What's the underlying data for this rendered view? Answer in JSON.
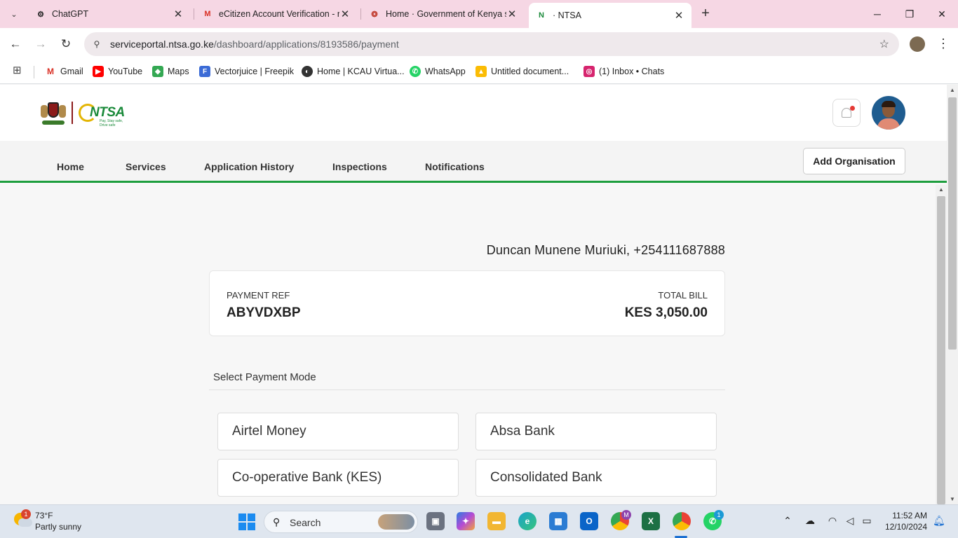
{
  "browser": {
    "tabs": [
      {
        "title": "ChatGPT",
        "icon": "chatgpt-icon"
      },
      {
        "title": "eCitizen Account Verification - r",
        "icon": "gmail-icon"
      },
      {
        "title": "Home · Government of Kenya s",
        "icon": "ecitizen-icon"
      },
      {
        "title": "· NTSA",
        "icon": "ntsa-icon",
        "active": true
      }
    ],
    "url_host": "serviceportal.ntsa.go.ke",
    "url_path": "/dashboard/applications/8193586/payment",
    "bookmarks": [
      {
        "label": "Gmail",
        "icon": "gmail-icon"
      },
      {
        "label": "YouTube",
        "icon": "youtube-icon"
      },
      {
        "label": "Maps",
        "icon": "maps-icon"
      },
      {
        "label": "Vectorjuice | Freepik",
        "icon": "freepik-icon"
      },
      {
        "label": "Home | KCAU Virtua...",
        "icon": "globe-icon"
      },
      {
        "label": "WhatsApp",
        "icon": "whatsapp-icon"
      },
      {
        "label": "Untitled document...",
        "icon": "drive-icon"
      },
      {
        "label": "(1) Inbox • Chats",
        "icon": "instagram-icon"
      }
    ]
  },
  "nav": {
    "items": [
      "Home",
      "Services",
      "Application History",
      "Inspections",
      "Notifications"
    ],
    "add_org": "Add Organisation"
  },
  "logo": {
    "ntsa": "NTSA",
    "tagline": "Pay, Stay safe, Drive safe"
  },
  "payment": {
    "payer": "Duncan Munene Muriuki, +254111687888",
    "ref_label": "PAYMENT REF",
    "ref_value": "ABYVDXBP",
    "total_label": "TOTAL BILL",
    "total_value": "KES 3,050.00",
    "mode_title": "Select Payment Mode",
    "modes": [
      "Airtel Money",
      "Absa Bank",
      "Co-operative Bank (KES)",
      "Consolidated Bank"
    ]
  },
  "taskbar": {
    "temp": "73°F",
    "condition": "Partly sunny",
    "weather_badge": "1",
    "search_label": "Search",
    "time": "11:52 AM",
    "date": "12/10/2024",
    "chrome_badge": "M",
    "whatsapp_badge": "1"
  },
  "colors": {
    "accent_green": "#1e9e3e",
    "tabstrip": "#f6d7e4"
  }
}
